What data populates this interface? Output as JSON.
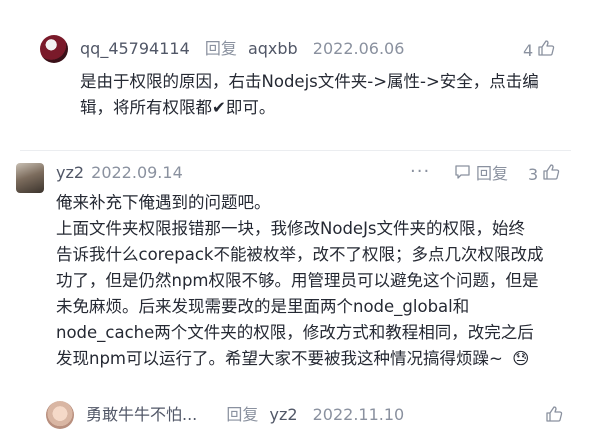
{
  "comment1": {
    "username": "qq_45794114",
    "reply_word": "回复",
    "reply_to": "aqxbb",
    "date": "2022.06.06",
    "likes": "4",
    "lines": [
      "是由于权限的原因，右击Nodejs文件夹->属性->安全，点击编",
      "辑，将所有权限都✔即可。"
    ]
  },
  "comment2": {
    "username": "yz2",
    "date": "2022.09.14",
    "more": "···",
    "reply_label": "回复",
    "likes": "3",
    "lines": [
      "俺来补充下俺遇到的问题吧。",
      "上面文件夹权限报错那一块，我修改NodeJs文件夹的权限，始终",
      "告诉我什么corepack不能被枚举，改不了权限；多点几次权限改成",
      "功了，但是仍然npm权限不够。用管理员可以避免这个问题，但是",
      "未免麻烦。后来发现需要改的是里面两个node_global和",
      "node_cache两个文件夹的权限，修改方式和教程相同，改完之后",
      "发现npm可以运行了。希望大家不要被我这种情况搞得烦躁~"
    ],
    "emoji": "😓"
  },
  "comment3": {
    "username": "勇敢牛牛不怕...",
    "reply_word": "回复",
    "reply_to": "yz2",
    "date": "2022.11.10"
  },
  "icons": {
    "like": "thumbs-up-icon",
    "reply": "comment-icon",
    "more": "more-dots-icon"
  }
}
